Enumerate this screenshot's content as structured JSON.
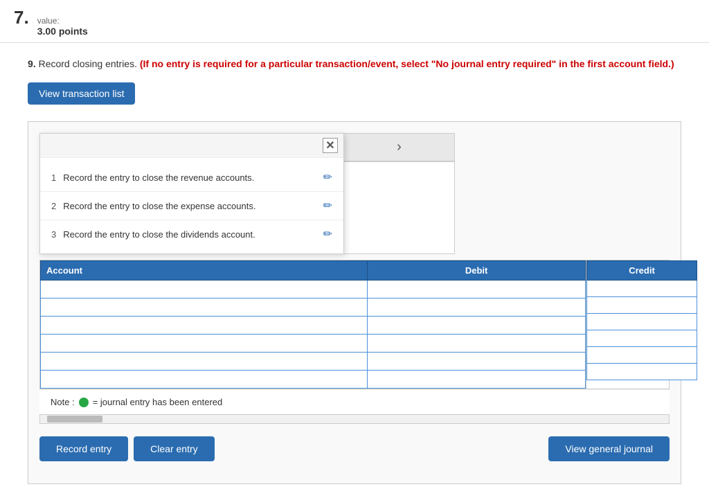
{
  "header": {
    "question_number": "7.",
    "value_label": "value:",
    "value": "3.00 points"
  },
  "question": {
    "number": "9.",
    "main_text": "Record closing entries.",
    "red_text": "(If no entry is required for a particular transaction/event, select \"No journal entry required\" in the first account field.)"
  },
  "view_transaction_btn": "View transaction list",
  "close_icon": "✕",
  "transactions": [
    {
      "num": "1",
      "text": "Record the entry to close the revenue accounts."
    },
    {
      "num": "2",
      "text": "Record the entry to close the expense accounts."
    },
    {
      "num": "3",
      "text": "Record the entry to close the dividends account."
    }
  ],
  "table_headers": {
    "debit": "Debit",
    "credit": "Credit"
  },
  "note_text": "= journal entry has been entered",
  "note_prefix": "Note :",
  "buttons": {
    "record_entry": "Record entry",
    "clear_entry": "Clear entry",
    "view_general_journal": "View general journal"
  }
}
